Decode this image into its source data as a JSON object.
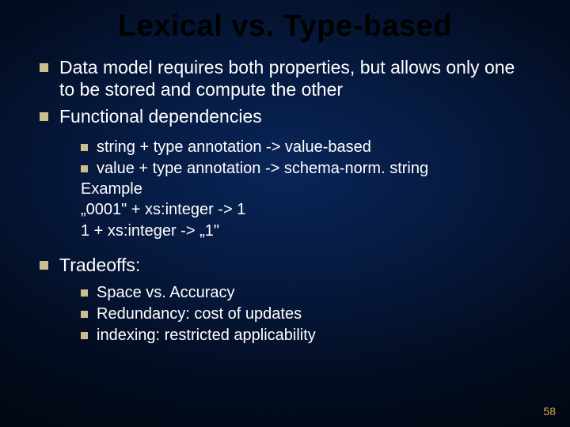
{
  "title": "Lexical vs. Type-based",
  "b1": "Data model requires both properties, but allows only one to be stored and compute the other",
  "b2": "Functional dependencies",
  "s1": "string + type annotation -> value-based",
  "s2": "value + type annotation -> schema-norm. string",
  "ex_head": "Example",
  "ex_l1": "„0001\" + xs:integer -> 1",
  "ex_l2": "1 + xs:integer -> „1\"",
  "b3": "Tradeoffs:",
  "t1": "Space vs. Accuracy",
  "t2": "Redundancy:  cost of updates",
  "t3": "indexing: restricted applicability",
  "page": "58"
}
